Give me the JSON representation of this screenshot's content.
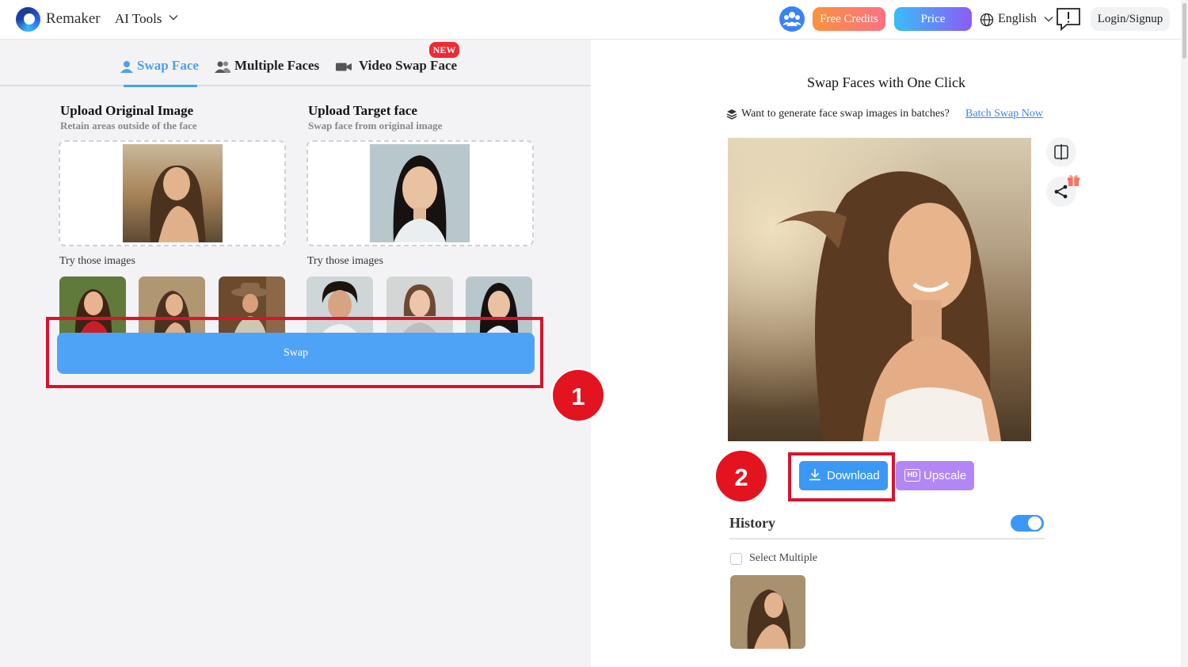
{
  "header": {
    "brand": "Remaker",
    "ai_tools": "AI Tools",
    "free_credits": "Free Credits",
    "price": "Price",
    "language": "English",
    "login": "Login/Signup",
    "icons": [
      "remaker-logo-icon",
      "chevron-down-icon",
      "community-icon",
      "globe-icon",
      "feedback-icon"
    ]
  },
  "tabs": [
    {
      "label": "Swap Face",
      "icon": "user-icon",
      "active": true
    },
    {
      "label": "Multiple Faces",
      "icon": "users-icon",
      "active": false
    },
    {
      "label": "Video Swap Face",
      "icon": "video-camera-icon",
      "active": false,
      "badge": "NEW"
    }
  ],
  "upload_original": {
    "title": "Upload Original Image",
    "subtitle": "Retain areas outside of the face",
    "try_label": "Try those images"
  },
  "upload_target": {
    "title": "Upload Target face",
    "subtitle": "Swap face from original image",
    "try_label": "Try those images"
  },
  "swap_button": "Swap",
  "steps": [
    "1",
    "2"
  ],
  "result": {
    "title": "Swap Faces with One Click",
    "batch_text": "Want to generate face swap images in batches?",
    "batch_link": "Batch Swap Now",
    "download": "Download",
    "upscale": "Upscale",
    "hd_badge": "HD"
  },
  "history": {
    "title": "History",
    "toggle_on": true,
    "select_multiple": "Select Multiple"
  },
  "colors": {
    "accent": "#4aa0ee",
    "swap_button": "#4fa3f7",
    "highlight": "#d8132c",
    "upscale": "#b287f5"
  }
}
